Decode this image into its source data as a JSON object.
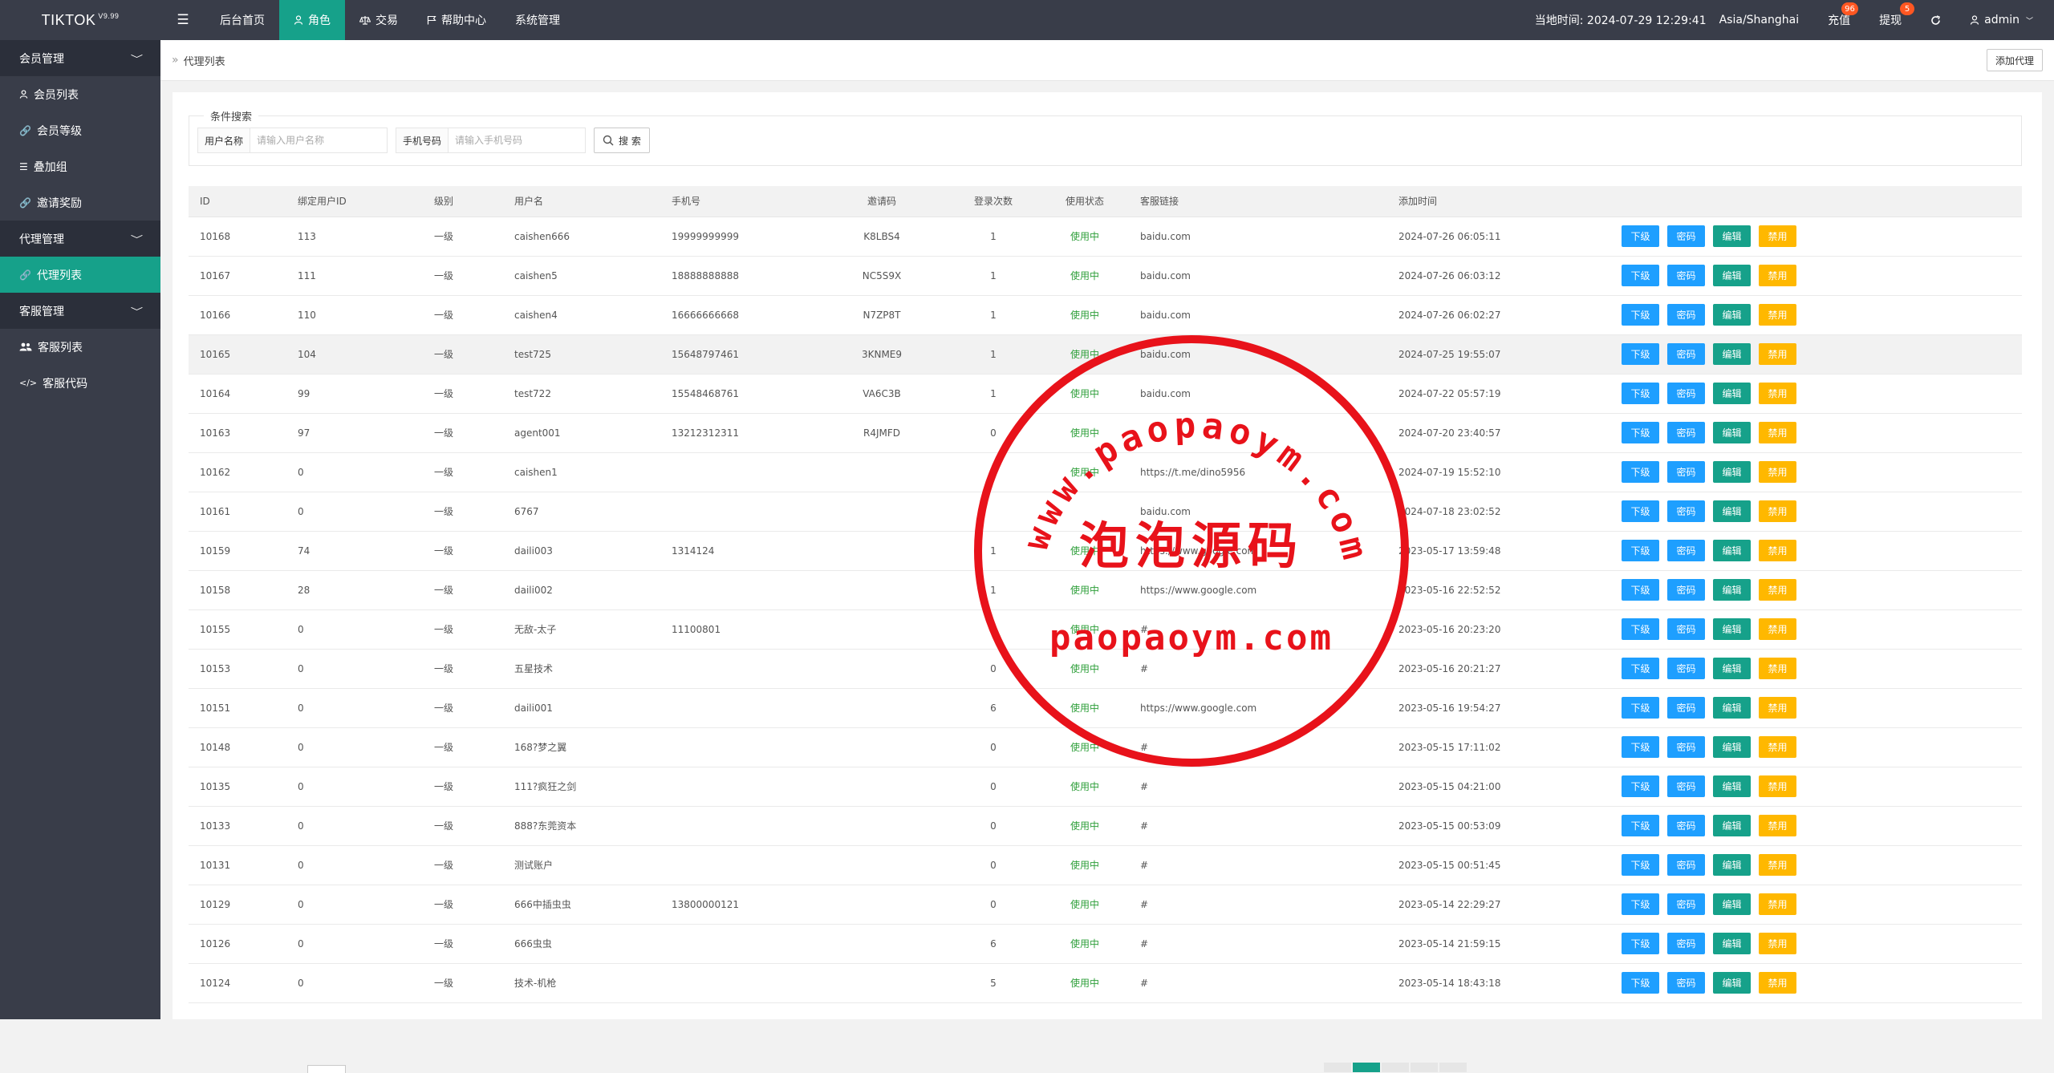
{
  "header": {
    "logo": "TIKTOK",
    "version": "V9.99",
    "nav": [
      {
        "label": "后台首页",
        "icon": "",
        "active": false
      },
      {
        "label": "角色",
        "icon": "user-icon",
        "active": true
      },
      {
        "label": "交易",
        "icon": "balance-icon",
        "active": false
      },
      {
        "label": "帮助中心",
        "icon": "flag-icon",
        "active": false
      },
      {
        "label": "系统管理",
        "icon": "",
        "active": false
      }
    ],
    "time_label": "当地时间: 2024-07-29 12:29:41",
    "timezone": "Asia/Shanghai",
    "recharge": {
      "label": "充值",
      "badge": "96"
    },
    "withdraw": {
      "label": "提现",
      "badge": "5"
    },
    "user": "admin"
  },
  "sidebar": [
    {
      "type": "group",
      "label": "会员管理"
    },
    {
      "type": "item",
      "label": "会员列表",
      "icon": "user-icon",
      "active": false
    },
    {
      "type": "item",
      "label": "会员等级",
      "icon": "link-icon",
      "active": false
    },
    {
      "type": "item",
      "label": "叠加组",
      "icon": "list-icon",
      "active": false
    },
    {
      "type": "item",
      "label": "邀请奖励",
      "icon": "link-icon",
      "active": false
    },
    {
      "type": "group",
      "label": "代理管理"
    },
    {
      "type": "item",
      "label": "代理列表",
      "icon": "link-icon",
      "active": true
    },
    {
      "type": "group",
      "label": "客服管理"
    },
    {
      "type": "item",
      "label": "客服列表",
      "icon": "users-icon",
      "active": false
    },
    {
      "type": "item",
      "label": "客服代码",
      "icon": "code-icon",
      "active": false
    }
  ],
  "breadcrumb": "代理列表",
  "add_button": "添加代理",
  "search": {
    "legend": "条件搜索",
    "username_label": "用户名称",
    "username_placeholder": "请输入用户名称",
    "phone_label": "手机号码",
    "phone_placeholder": "请输入手机号码",
    "button": "搜 索"
  },
  "table": {
    "columns": [
      "ID",
      "绑定用户ID",
      "级别",
      "用户名",
      "手机号",
      "邀请码",
      "登录次数",
      "使用状态",
      "客服链接",
      "添加时间",
      ""
    ],
    "buttons": [
      "下级",
      "密码",
      "编辑",
      "禁用"
    ],
    "rows": [
      {
        "id": "10168",
        "uid": "113",
        "level": "一级",
        "name": "caishen666",
        "phone": "19999999999",
        "code": "K8LBS4",
        "logins": "1",
        "status": "使用中",
        "link": "baidu.com",
        "time": "2024-07-26 06:05:11"
      },
      {
        "id": "10167",
        "uid": "111",
        "level": "一级",
        "name": "caishen5",
        "phone": "18888888888",
        "code": "NC5S9X",
        "logins": "1",
        "status": "使用中",
        "link": "baidu.com",
        "time": "2024-07-26 06:03:12"
      },
      {
        "id": "10166",
        "uid": "110",
        "level": "一级",
        "name": "caishen4",
        "phone": "16666666668",
        "code": "N7ZP8T",
        "logins": "1",
        "status": "使用中",
        "link": "baidu.com",
        "time": "2024-07-26 06:02:27"
      },
      {
        "id": "10165",
        "uid": "104",
        "level": "一级",
        "name": "test725",
        "phone": "15648797461",
        "code": "3KNME9",
        "logins": "1",
        "status": "使用中",
        "link": "baidu.com",
        "time": "2024-07-25 19:55:07",
        "hl": true
      },
      {
        "id": "10164",
        "uid": "99",
        "level": "一级",
        "name": "test722",
        "phone": "15548468761",
        "code": "VA6C3B",
        "logins": "1",
        "status": "使用中",
        "link": "baidu.com",
        "time": "2024-07-22 05:57:19"
      },
      {
        "id": "10163",
        "uid": "97",
        "level": "一级",
        "name": "agent001",
        "phone": "13212312311",
        "code": "R4JMFD",
        "logins": "0",
        "status": "使用中",
        "link": "",
        "time": "2024-07-20 23:40:57"
      },
      {
        "id": "10162",
        "uid": "0",
        "level": "一级",
        "name": "caishen1",
        "phone": "",
        "code": "",
        "logins": "2",
        "status": "使用中",
        "link": "https://t.me/dino5956",
        "time": "2024-07-19 15:52:10"
      },
      {
        "id": "10161",
        "uid": "0",
        "level": "一级",
        "name": "6767",
        "phone": "",
        "code": "",
        "logins": "",
        "status": "",
        "link": "baidu.com",
        "time": "2024-07-18 23:02:52"
      },
      {
        "id": "10159",
        "uid": "74",
        "level": "一级",
        "name": "daili003",
        "phone": "1314124",
        "code": "",
        "logins": "1",
        "status": "使用中",
        "link": "https://www.google.com",
        "time": "2023-05-17 13:59:48"
      },
      {
        "id": "10158",
        "uid": "28",
        "level": "一级",
        "name": "daili002",
        "phone": "",
        "code": "",
        "logins": "1",
        "status": "使用中",
        "link": "https://www.google.com",
        "time": "2023-05-16 22:52:52"
      },
      {
        "id": "10155",
        "uid": "0",
        "level": "一级",
        "name": "无敌-太子",
        "phone": "11100801",
        "code": "",
        "logins": "0",
        "status": "使用中",
        "link": "#",
        "time": "2023-05-16 20:23:20"
      },
      {
        "id": "10153",
        "uid": "0",
        "level": "一级",
        "name": "五星技术",
        "phone": "",
        "code": "",
        "logins": "0",
        "status": "使用中",
        "link": "#",
        "time": "2023-05-16 20:21:27"
      },
      {
        "id": "10151",
        "uid": "0",
        "level": "一级",
        "name": "daili001",
        "phone": "",
        "code": "",
        "logins": "6",
        "status": "使用中",
        "link": "https://www.google.com",
        "time": "2023-05-16 19:54:27"
      },
      {
        "id": "10148",
        "uid": "0",
        "level": "一级",
        "name": "168?梦之翼",
        "phone": "",
        "code": "",
        "logins": "0",
        "status": "使用中",
        "link": "#",
        "time": "2023-05-15 17:11:02"
      },
      {
        "id": "10135",
        "uid": "0",
        "level": "一级",
        "name": "111?疯狂之剑",
        "phone": "",
        "code": "",
        "logins": "0",
        "status": "使用中",
        "link": "#",
        "time": "2023-05-15 04:21:00"
      },
      {
        "id": "10133",
        "uid": "0",
        "level": "一级",
        "name": "888?东莞资本",
        "phone": "",
        "code": "",
        "logins": "0",
        "status": "使用中",
        "link": "#",
        "time": "2023-05-15 00:53:09"
      },
      {
        "id": "10131",
        "uid": "0",
        "level": "一级",
        "name": "测试账户",
        "phone": "",
        "code": "",
        "logins": "0",
        "status": "使用中",
        "link": "#",
        "time": "2023-05-15 00:51:45"
      },
      {
        "id": "10129",
        "uid": "0",
        "level": "一级",
        "name": "666中插虫虫",
        "phone": "13800000121",
        "code": "",
        "logins": "0",
        "status": "使用中",
        "link": "#",
        "time": "2023-05-14 22:29:27"
      },
      {
        "id": "10126",
        "uid": "0",
        "level": "一级",
        "name": "666虫虫",
        "phone": "",
        "code": "",
        "logins": "6",
        "status": "使用中",
        "link": "#",
        "time": "2023-05-14 21:59:15"
      },
      {
        "id": "10124",
        "uid": "0",
        "level": "一级",
        "name": "技术-机枪",
        "phone": "",
        "code": "",
        "logins": "5",
        "status": "使用中",
        "link": "#",
        "time": "2023-05-14 18:43:18"
      }
    ]
  },
  "watermark": {
    "top_text": "www.paopaoym.com",
    "middle_text": "泡泡源码",
    "bottom_text": "paopaoym.com",
    "color": "#e8121a"
  }
}
